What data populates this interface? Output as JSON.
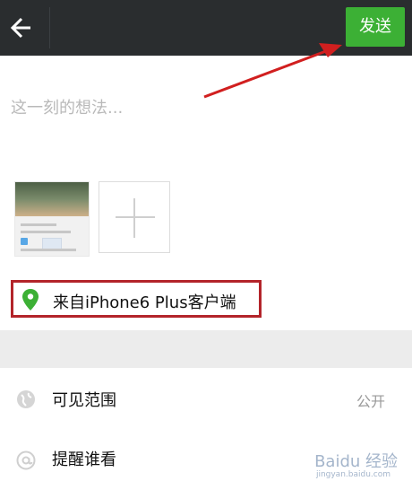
{
  "header": {
    "send_label": "发送"
  },
  "composer": {
    "placeholder": "这一刻的想法..."
  },
  "location": {
    "label": "来自iPhone6 Plus客户端"
  },
  "settings": {
    "visibility_label": "可见范围",
    "visibility_value": "公开",
    "remind_label": "提醒谁看"
  },
  "colors": {
    "topbar": "#2a2d2f",
    "send_button": "#3cb035",
    "annotation": "#b3242a",
    "location_pin": "#3cb035"
  },
  "watermark": {
    "text": "Baidu 经验",
    "sub": "jingyan.baidu.com"
  }
}
